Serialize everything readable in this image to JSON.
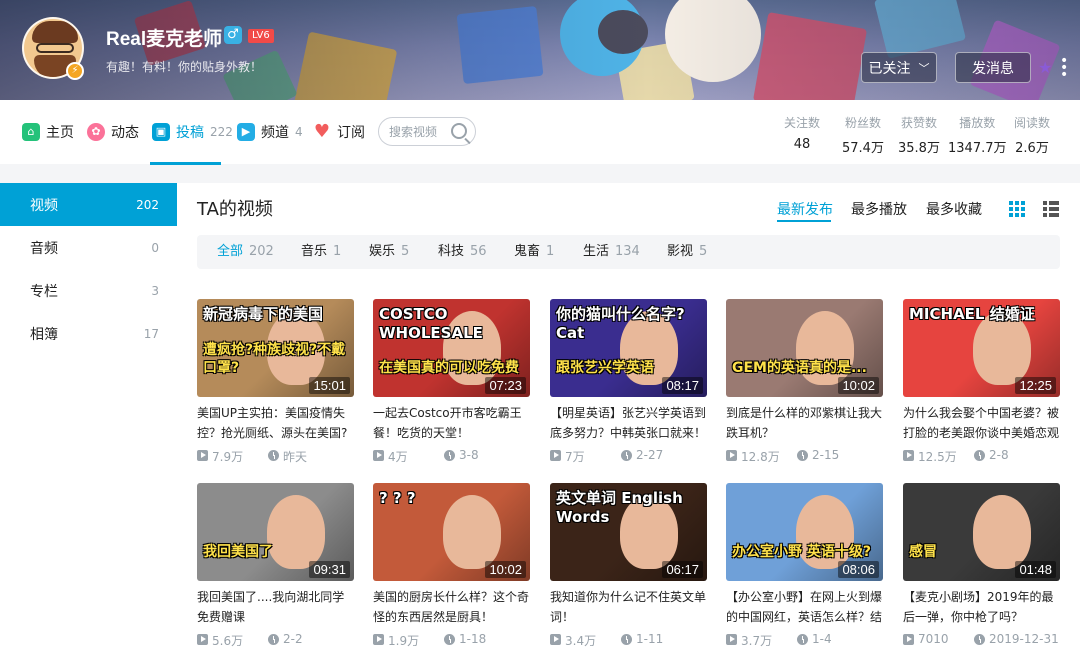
{
  "profile": {
    "name": "Real麦克老师",
    "level": "LV6",
    "signature": "有趣！有料！你的贴身外教！",
    "follow_label": "已关注",
    "message_label": "发消息"
  },
  "nav": {
    "home": "主页",
    "dynamic": "动态",
    "uploads": "投稿",
    "uploads_count": "222",
    "channels": "频道",
    "channels_count": "4",
    "subscriptions": "订阅",
    "search_placeholder": "搜索视频"
  },
  "stats": [
    {
      "label": "关注数",
      "value": "48"
    },
    {
      "label": "粉丝数",
      "value": "57.4万"
    },
    {
      "label": "获赞数",
      "value": "35.8万"
    },
    {
      "label": "播放数",
      "value": "1347.7万"
    },
    {
      "label": "阅读数",
      "value": "2.6万"
    }
  ],
  "sidebar": {
    "items": [
      {
        "label": "视频",
        "count": "202"
      },
      {
        "label": "音频",
        "count": "0"
      },
      {
        "label": "专栏",
        "count": "3"
      },
      {
        "label": "相簿",
        "count": "17"
      }
    ]
  },
  "main": {
    "title": "TA的视频",
    "sort_tabs": [
      "最新发布",
      "最多播放",
      "最多收藏"
    ],
    "filters": [
      {
        "label": "全部",
        "count": "202"
      },
      {
        "label": "音乐",
        "count": "1"
      },
      {
        "label": "娱乐",
        "count": "5"
      },
      {
        "label": "科技",
        "count": "56"
      },
      {
        "label": "鬼畜",
        "count": "1"
      },
      {
        "label": "生活",
        "count": "134"
      },
      {
        "label": "影视",
        "count": "5"
      }
    ]
  },
  "videos": [
    {
      "title": "美国UP主实拍：美国疫情失控？抢光厕纸、源头在美国?",
      "duration": "15:01",
      "views": "7.9万",
      "date": "昨天",
      "caption": "新冠病毒下的美国",
      "caption2": "遭疯抢?种族歧视?不戴口罩?",
      "bg": "#b58b5a"
    },
    {
      "title": "一起去Costco开市客吃霸王餐！吃货的天堂！",
      "duration": "07:23",
      "views": "4万",
      "date": "3-8",
      "caption": "COSTCO WHOLESALE",
      "caption2": "在美国真的可以吃免费",
      "bg": "#c0332f"
    },
    {
      "title": "【明星英语】张艺兴学英语到底多努力？中韩英张口就来！",
      "duration": "08:17",
      "views": "7万",
      "date": "2-27",
      "caption": "你的猫叫什么名字? Cat",
      "caption2": "跟张艺兴学英语",
      "bg": "#3a2d8f"
    },
    {
      "title": "到底是什么样的邓紫棋让我大跌耳机？",
      "duration": "10:02",
      "views": "12.8万",
      "date": "2-15",
      "caption": "",
      "caption2": "GEM的英语真的是...",
      "bg": "#9a7a72"
    },
    {
      "title": "为什么我会娶个中国老婆？被打脸的老美跟你谈中美婚恋观",
      "duration": "12:25",
      "views": "12.5万",
      "date": "2-8",
      "caption": "MICHAEL 结婚证",
      "caption2": "",
      "bg": "#e6443f"
    },
    {
      "title": "我回美国了....我向湖北同学免费赠课",
      "duration": "09:31",
      "views": "5.6万",
      "date": "2-2",
      "caption": "",
      "caption2": "我回美国了",
      "bg": "#8c8c8c"
    },
    {
      "title": "美国的厨房长什么样？这个奇怪的东西居然是厨具！",
      "duration": "10:02",
      "views": "1.9万",
      "date": "1-18",
      "caption": "? ? ?",
      "caption2": "",
      "bg": "#c35a3a"
    },
    {
      "title": "我知道你为什么记不住英文单词！",
      "duration": "06:17",
      "views": "3.4万",
      "date": "1-11",
      "caption": "英文单词 English Words",
      "caption2": "",
      "bg": "#3b2418"
    },
    {
      "title": "【办公室小野】在网上火到爆的中国网红，英语怎么样？结",
      "duration": "08:06",
      "views": "3.7万",
      "date": "1-4",
      "caption": "",
      "caption2": "办公室小野 英语十级?",
      "bg": "#6fa0d8"
    },
    {
      "title": "【麦克小剧场】2019年的最后一弹，你中枪了吗？",
      "duration": "01:48",
      "views": "7010",
      "date": "2019-12-31",
      "caption": "",
      "caption2": "感冒",
      "bg": "#3a3a3a"
    }
  ],
  "colors": {
    "accent": "#00a1d6",
    "muted": "#99a2aa",
    "level": "#f14a48"
  }
}
